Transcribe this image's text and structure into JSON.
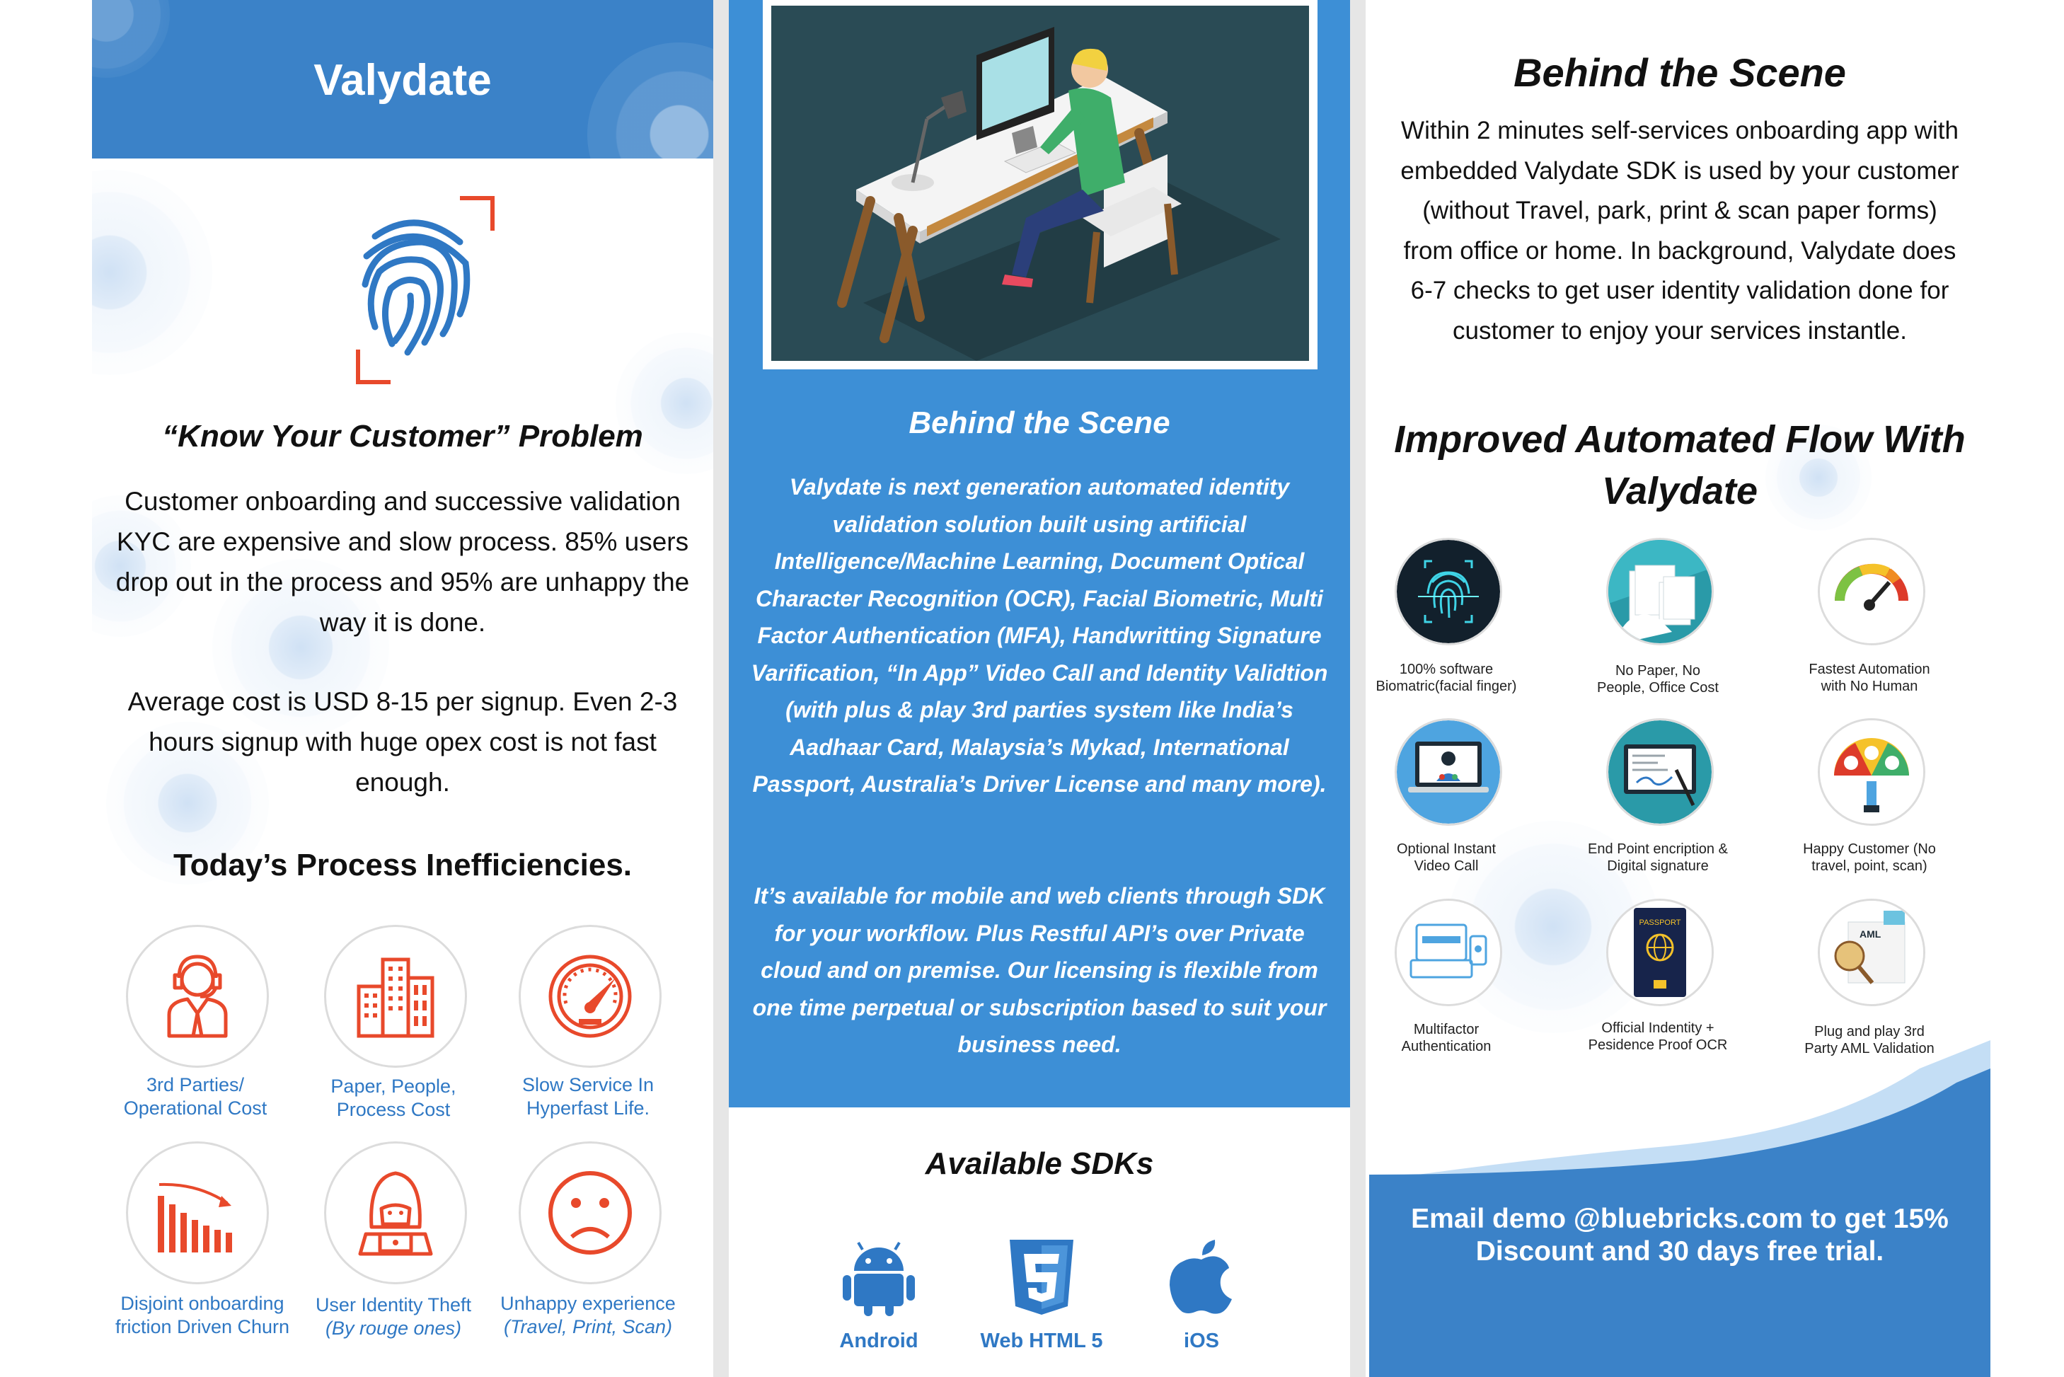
{
  "panel1": {
    "title": "Valydate",
    "kyc_heading": "“Know Your Customer” Problem",
    "kyc_paragraph": "Customer onboarding and successive validation KYC are expensive and slow process. 85% users drop out in the process and 95% are unhappy the way it is done.",
    "cost_paragraph": "Average cost is USD 8-15 per signup. Even 2-3 hours signup with huge opex cost is not fast enough.",
    "inefficiencies_heading": "Today’s Process Inefficiencies.",
    "inefficiencies": [
      {
        "icon": "operator-icon",
        "line1": "3rd Parties/",
        "line2": "Operational Cost"
      },
      {
        "icon": "buildings-icon",
        "line1": "Paper, People,",
        "line2": "Process Cost"
      },
      {
        "icon": "speedometer-icon",
        "line1": "Slow Service In",
        "line2": "Hyperfast Life."
      },
      {
        "icon": "declining-chart-icon",
        "line1": "Disjoint onboarding",
        "line2": "friction Driven Churn"
      },
      {
        "icon": "hacker-icon",
        "line1": "User Identity Theft",
        "line2": "(By rouge ones)"
      },
      {
        "icon": "sad-face-icon",
        "line1": "Unhappy experience",
        "line2": "(Travel, Print, Scan)"
      }
    ]
  },
  "panel2": {
    "heading": "Behind the Scene",
    "paragraph1": "Valydate is next generation automated identity validation solution built using artificial Intelligence/Machine Learning, Document Optical Character Recognition (OCR), Facial Biometric, Multi Factor Authentication (MFA), Handwritting Signature Varification, “In App” Video Call and Identity Validtion (with plus & play 3rd parties system like India’s Aadhaar Card, Malaysia’s Mykad, International Passport, Australia’s Driver License and many more).",
    "paragraph2": "It’s available for mobile and web clients through SDK for your workflow. Plus Restful API’s over Private cloud and on premise. Our licensing is flexible from one time perpetual or subscription based to suit your business need.",
    "sdk_heading": "Available SDKs",
    "sdks": [
      {
        "icon": "android-icon",
        "label": "Android"
      },
      {
        "icon": "html5-icon",
        "label": "Web HTML 5"
      },
      {
        "icon": "apple-icon",
        "label": "iOS"
      }
    ]
  },
  "panel3": {
    "heading": "Behind the Scene",
    "paragraph": "Within 2 minutes self-services onboarding app with embedded Valydate SDK is used by your customer (without Travel, park, print & scan paper forms) from office or home. In background, Valydate does 6-7 checks to get user identity validation done for customer to enjoy your services instantle.",
    "flow_heading_line1": "Improved Automated Flow With",
    "flow_heading_line2": "Valydate",
    "features": [
      {
        "icon": "fingerprint-scan-icon",
        "line1": "100% software",
        "line2": "Biomatric(facial finger)"
      },
      {
        "icon": "paper-stack-icon",
        "line1": "No Paper, No",
        "line2": "People, Office Cost"
      },
      {
        "icon": "gauge-icon",
        "line1": "Fastest Automation",
        "line2": "with No Human"
      },
      {
        "icon": "video-call-icon",
        "line1": "Optional Instant",
        "line2": "Video Call"
      },
      {
        "icon": "signature-icon",
        "line1": "End Point encription &",
        "line2": "Digital signature"
      },
      {
        "icon": "happy-customer-icon",
        "line1": "Happy Customer (No",
        "line2": "travel, point, scan)"
      },
      {
        "icon": "multifactor-icon",
        "line1": "Multifactor",
        "line2": "Authentication"
      },
      {
        "icon": "passport-icon",
        "line1": "Official Indentity +",
        "line2": "Pesidence Proof OCR"
      },
      {
        "icon": "aml-icon",
        "line1": "Plug and play 3rd",
        "line2": "Party AML Validation"
      }
    ],
    "passport_text": "PASSPORT",
    "aml_text": "AML",
    "email_line1": "Email demo @bluebricks.com to get 15%",
    "email_line2": "Discount and 30 days free trial."
  },
  "colors": {
    "brand_blue": "#3b82c8",
    "panel_blue": "#3d8fd6",
    "label_blue": "#2f78c4",
    "icon_red": "#e8492b"
  }
}
